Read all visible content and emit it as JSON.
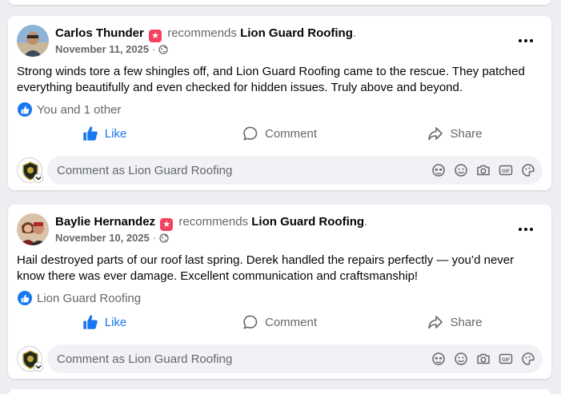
{
  "posts": [
    {
      "author": "Carlos Thunder",
      "recommends_text": "recommends",
      "page_name": "Lion Guard Roofing",
      "date": "November 11, 2025",
      "body": "Strong winds tore a few shingles off, and Lion Guard Roofing came to the rescue. They patched everything beautifully and even checked for hidden issues. Truly above and beyond.",
      "reactions_text": "You and 1 other",
      "like_label": "Like",
      "comment_label": "Comment",
      "share_label": "Share",
      "comment_placeholder": "Comment as Lion Guard Roofing"
    },
    {
      "author": "Baylie Hernandez",
      "recommends_text": "recommends",
      "page_name": "Lion Guard Roofing",
      "date": "November 10, 2025",
      "body": "Hail destroyed parts of our roof last spring. Derek handled the repairs perfectly — you’d never know there was ever damage. Excellent communication and craftsmanship!",
      "reactions_text": "Lion Guard Roofing",
      "like_label": "Like",
      "comment_label": "Comment",
      "share_label": "Share",
      "comment_placeholder": "Comment as Lion Guard Roofing"
    }
  ],
  "icons": {
    "badge": "recommend-badge-icon",
    "privacy": "globe-icon",
    "more": "more-options-icon",
    "like": "thumbs-up-icon",
    "comment": "speech-bubble-icon",
    "share": "share-arrow-icon",
    "tools": [
      "avatar-sticker-icon",
      "emoji-icon",
      "camera-icon",
      "gif-icon",
      "sticker-icon"
    ]
  },
  "colors": {
    "accent": "#1877f2",
    "badge": "#f3425f",
    "muted": "#65676b",
    "input_bg": "#f0f2f5",
    "page_bg": "#eceef1"
  }
}
